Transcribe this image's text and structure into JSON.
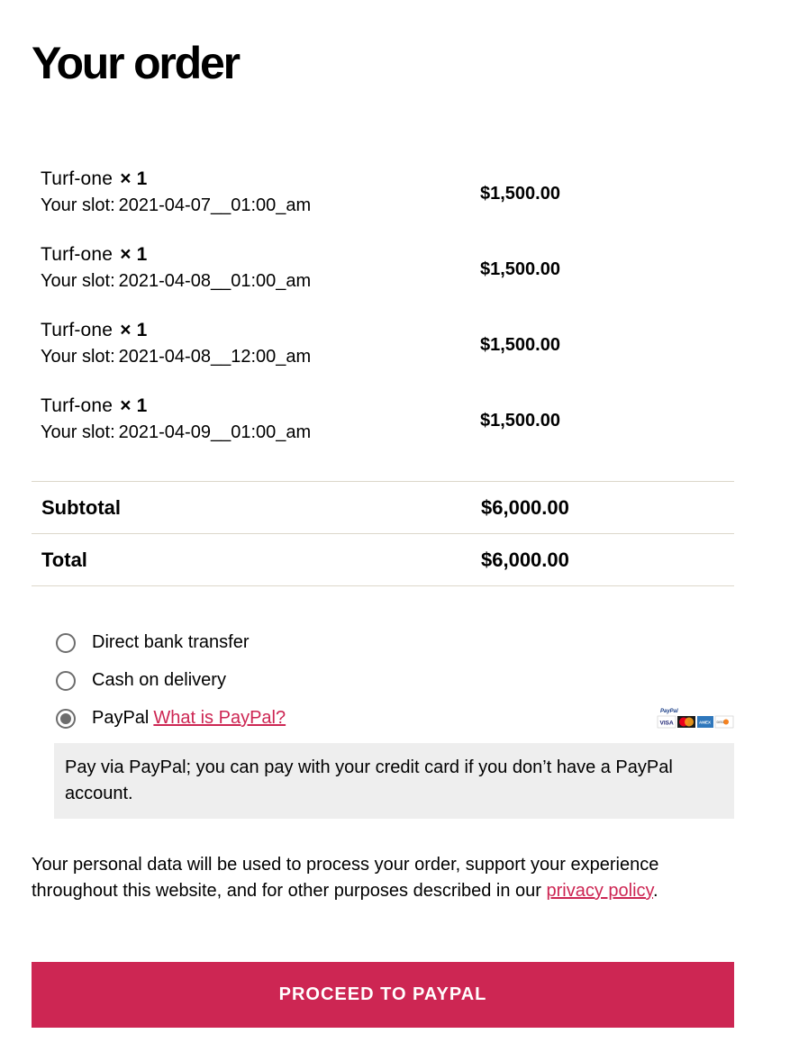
{
  "page": {
    "title": "Your order"
  },
  "order_items": [
    {
      "name": "Turf-one",
      "qty": "× 1",
      "slot_label": "Your slot:",
      "slot": "2021-04-07__01:00_am",
      "price": "$1,500.00"
    },
    {
      "name": "Turf-one",
      "qty": "× 1",
      "slot_label": "Your slot:",
      "slot": "2021-04-08__01:00_am",
      "price": "$1,500.00"
    },
    {
      "name": "Turf-one",
      "qty": "× 1",
      "slot_label": "Your slot:",
      "slot": "2021-04-08__12:00_am",
      "price": "$1,500.00"
    },
    {
      "name": "Turf-one",
      "qty": "× 1",
      "slot_label": "Your slot:",
      "slot": "2021-04-09__01:00_am",
      "price": "$1,500.00"
    }
  ],
  "totals": {
    "subtotal_label": "Subtotal",
    "subtotal_value": "$6,000.00",
    "total_label": "Total",
    "total_value": "$6,000.00"
  },
  "payment": {
    "selected": "paypal",
    "options": [
      {
        "id": "bacs",
        "label": "Direct bank transfer"
      },
      {
        "id": "cod",
        "label": "Cash on delivery"
      },
      {
        "id": "paypal",
        "label": "PayPal",
        "link_text": "What is PayPal?",
        "icon": "paypal-accepted-cards-icon"
      }
    ],
    "paypal_description": "Pay via PayPal; you can pay with your credit card if you don’t have a PayPal account."
  },
  "privacy": {
    "text": "Your personal data will be used to process your order, support your experience throughout this website, and for other purposes described in our ",
    "link_text": "privacy policy",
    "suffix": "."
  },
  "actions": {
    "proceed_label": "PROCEED TO PAYPAL"
  },
  "colors": {
    "accent": "#cd2653",
    "description_bg": "#eeeeee",
    "divider": "#dcd7ca",
    "radio": "#6d6d6d"
  }
}
